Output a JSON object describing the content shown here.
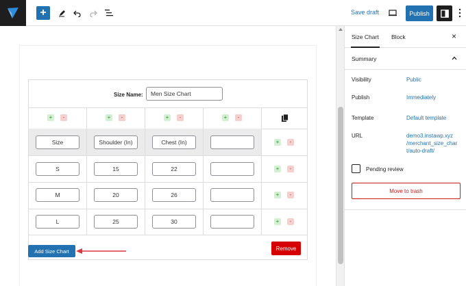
{
  "toolbar": {
    "add_block_label": "+",
    "save_draft": "Save draft",
    "publish": "Publish"
  },
  "editor": {
    "size_name_label": "Size Name:",
    "size_name_value": "Men Size Chart",
    "table": {
      "headers": [
        "Size",
        "Shoulder (In)",
        "Chest (In)",
        ""
      ],
      "rows": [
        [
          "S",
          "15",
          "22",
          ""
        ],
        [
          "M",
          "20",
          "26",
          ""
        ],
        [
          "L",
          "25",
          "30",
          ""
        ]
      ]
    },
    "add_symbol": "+",
    "remove_symbol": "-",
    "remove_button": "Remove",
    "add_size_chart_button": "Add Size Chart",
    "accent_color": "#2271b1",
    "annotation_arrow_color": "#d9363e"
  },
  "sidebar": {
    "tab_primary": "Size Chart",
    "tab_secondary": "Block",
    "close": "×",
    "summary_title": "Summary",
    "visibility_label": "Visibility",
    "visibility_value": "Public",
    "publish_label": "Publish",
    "publish_value": "Immediately",
    "template_label": "Template",
    "template_value": "Default template",
    "url_label": "URL",
    "url_line1": "demo3.instawp.xyz",
    "url_line2": "/merchant_size_char",
    "url_line3": "t/auto-draft/",
    "pending_review": "Pending review",
    "move_to_trash": "Move to trash"
  }
}
